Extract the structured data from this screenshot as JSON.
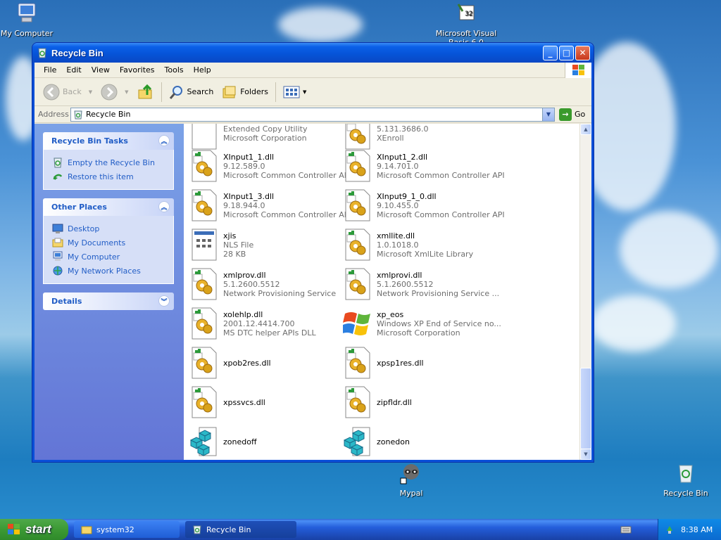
{
  "desktop": {
    "icons": [
      {
        "label": "My Computer"
      },
      {
        "label": "Microsoft Visual Basic 6.0"
      },
      {
        "label": "Mypal"
      },
      {
        "label": "Recycle Bin"
      }
    ]
  },
  "window": {
    "title": "Recycle Bin",
    "menu": [
      "File",
      "Edit",
      "View",
      "Favorites",
      "Tools",
      "Help"
    ],
    "toolbar": {
      "back": "Back",
      "search": "Search",
      "folders": "Folders"
    },
    "address": {
      "label": "Address",
      "value": "Recycle Bin",
      "go": "Go"
    },
    "tasks_panel": {
      "title": "Recycle Bin Tasks",
      "items": [
        "Empty the Recycle Bin",
        "Restore this item"
      ]
    },
    "places_panel": {
      "title": "Other Places",
      "items": [
        "Desktop",
        "My Documents",
        "My Computer",
        "My Network Places"
      ]
    },
    "details_panel": {
      "title": "Details"
    },
    "files": [
      {
        "name": "",
        "line2": "Extended Copy Utility",
        "line3": "Microsoft Corporation",
        "icon": "blank-doc"
      },
      {
        "name": "",
        "line2": "5.131.3686.0",
        "line3": "XEnroll",
        "icon": "dll"
      },
      {
        "name": "XInput1_1.dll",
        "line2": "9.12.589.0",
        "line3": "Microsoft Common Controller API",
        "icon": "dll"
      },
      {
        "name": "XInput1_2.dll",
        "line2": "9.14.701.0",
        "line3": "Microsoft Common Controller API",
        "icon": "dll"
      },
      {
        "name": "XInput1_3.dll",
        "line2": "9.18.944.0",
        "line3": "Microsoft Common Controller API",
        "icon": "dll"
      },
      {
        "name": "XInput9_1_0.dll",
        "line2": "9.10.455.0",
        "line3": "Microsoft Common Controller API",
        "icon": "dll"
      },
      {
        "name": "xjis",
        "line2": "NLS File",
        "line3": "28 KB",
        "icon": "nls"
      },
      {
        "name": "xmllite.dll",
        "line2": "1.0.1018.0",
        "line3": "Microsoft XmlLite Library",
        "icon": "dll"
      },
      {
        "name": "xmlprov.dll",
        "line2": "5.1.2600.5512",
        "line3": "Network Provisioning Service",
        "icon": "dll"
      },
      {
        "name": "xmlprovi.dll",
        "line2": "5.1.2600.5512",
        "line3": "Network Provisioning Service ...",
        "icon": "dll"
      },
      {
        "name": "xolehlp.dll",
        "line2": "2001.12.4414.700",
        "line3": "MS DTC helper APIs DLL",
        "icon": "dll"
      },
      {
        "name": "xp_eos",
        "line2": "Windows XP End of Service no...",
        "line3": "Microsoft Corporation",
        "icon": "xp-logo"
      },
      {
        "name": "xpob2res.dll",
        "line2": "",
        "line3": "",
        "icon": "dll"
      },
      {
        "name": "xpsp1res.dll",
        "line2": "",
        "line3": "",
        "icon": "dll"
      },
      {
        "name": "xpssvcs.dll",
        "line2": "",
        "line3": "",
        "icon": "dll"
      },
      {
        "name": "zipfldr.dll",
        "line2": "",
        "line3": "",
        "icon": "dll"
      },
      {
        "name": "zonedoff",
        "line2": "",
        "line3": "",
        "icon": "reg"
      },
      {
        "name": "zonedon",
        "line2": "",
        "line3": "",
        "icon": "reg"
      }
    ]
  },
  "taskbar": {
    "start": "start",
    "tasks": [
      "system32",
      "Recycle Bin"
    ],
    "clock": "8:38 AM"
  }
}
